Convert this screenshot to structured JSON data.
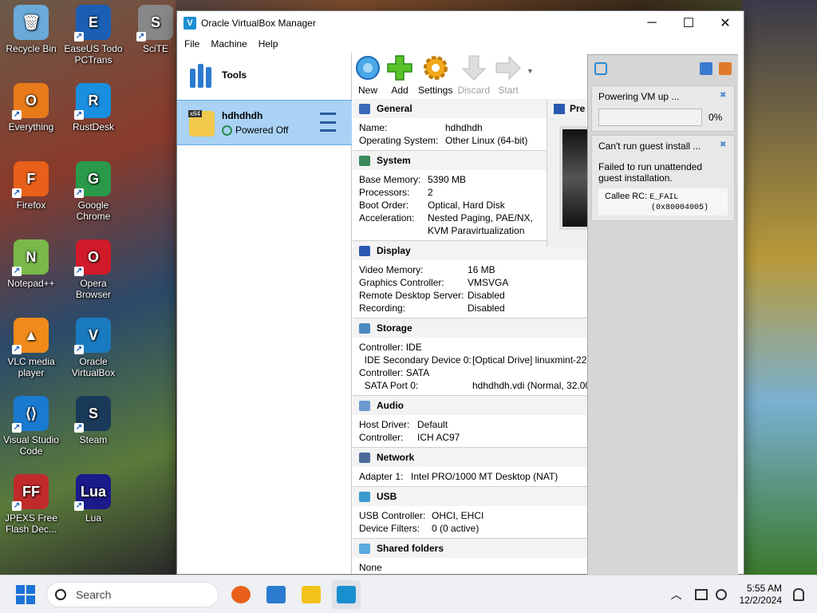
{
  "desktop": {
    "icons": [
      {
        "label": "Recycle Bin",
        "color": "#6aa9d8",
        "glyph": "🗑"
      },
      {
        "label": "EaseUS Todo PCTrans",
        "color": "#1a5fb4",
        "glyph": "E"
      },
      {
        "label": "SciTE",
        "color": "#888888",
        "glyph": "S"
      },
      {
        "label": "Everything",
        "color": "#e87a1a",
        "glyph": "O"
      },
      {
        "label": "RustDesk",
        "color": "#1a8fe0",
        "glyph": "R"
      },
      {
        "label": "Firefox",
        "color": "#e8601a",
        "glyph": "F"
      },
      {
        "label": "Google Chrome",
        "color": "#2a9a4a",
        "glyph": "G"
      },
      {
        "label": "Notepad++",
        "color": "#7ab84a",
        "glyph": "N"
      },
      {
        "label": "Opera Browser",
        "color": "#d01a2a",
        "glyph": "O"
      },
      {
        "label": "VLC media player",
        "color": "#f08a1a",
        "glyph": "▲"
      },
      {
        "label": "Oracle VirtualBox",
        "color": "#1a7ac0",
        "glyph": "V"
      },
      {
        "label": "Visual Studio Code",
        "color": "#1a7ad0",
        "glyph": "⟨⟩"
      },
      {
        "label": "Steam",
        "color": "#1a3a5a",
        "glyph": "S"
      },
      {
        "label": "JPEXS Free Flash Dec...",
        "color": "#c02a2a",
        "glyph": "FF"
      },
      {
        "label": "Lua",
        "color": "#1a1a8a",
        "glyph": "Lua"
      }
    ]
  },
  "window": {
    "title": "Oracle VirtualBox Manager",
    "controls": {
      "minimize": "─",
      "maximize": "☐",
      "close": "✕"
    },
    "menu": [
      "File",
      "Machine",
      "Help"
    ]
  },
  "left": {
    "tools_label": "Tools",
    "vm": {
      "name": "hdhdhdh",
      "state": "Powered Off",
      "os_tag": "x64"
    }
  },
  "toolbar": {
    "new": "New",
    "add": "Add",
    "settings": "Settings",
    "discard": "Discard",
    "start": "Start"
  },
  "details": {
    "general": {
      "title": "General",
      "rows": [
        {
          "k": "Name:",
          "v": "hdhdhdh"
        },
        {
          "k": "Operating System:",
          "v": "Other Linux (64-bit)"
        }
      ]
    },
    "system": {
      "title": "System",
      "rows": [
        {
          "k": "Base Memory:",
          "v": "5390 MB"
        },
        {
          "k": "Processors:",
          "v": "2"
        },
        {
          "k": "Boot Order:",
          "v": "Optical, Hard Disk"
        },
        {
          "k": "Acceleration:",
          "v": "Nested Paging, PAE/NX,"
        },
        {
          "k": "",
          "v": "KVM Paravirtualization"
        }
      ]
    },
    "display": {
      "title": "Display",
      "rows": [
        {
          "k": "Video Memory:",
          "v": "16 MB"
        },
        {
          "k": "Graphics Controller:",
          "v": "VMSVGA"
        },
        {
          "k": "Remote Desktop Server:",
          "v": "Disabled"
        },
        {
          "k": "Recording:",
          "v": "Disabled"
        }
      ]
    },
    "storage": {
      "title": "Storage",
      "rows": [
        {
          "k": "Controller: IDE",
          "v": ""
        },
        {
          "k": "  IDE Secondary Device 0:",
          "v": "[Optical Drive] linuxmint-22"
        },
        {
          "k": "Controller: SATA",
          "v": ""
        },
        {
          "k": "  SATA Port 0:",
          "v": "hdhdhdh.vdi (Normal, 32.00"
        }
      ]
    },
    "audio": {
      "title": "Audio",
      "rows": [
        {
          "k": "Host Driver:",
          "v": "Default"
        },
        {
          "k": "Controller:",
          "v": "ICH AC97"
        }
      ]
    },
    "network": {
      "title": "Network",
      "rows": [
        {
          "k": "Adapter 1:",
          "v": "Intel PRO/1000 MT Desktop (NAT)"
        }
      ]
    },
    "usb": {
      "title": "USB",
      "rows": [
        {
          "k": "USB Controller:",
          "v": "OHCI, EHCI"
        },
        {
          "k": "Device Filters:",
          "v": "0 (0 active)"
        }
      ]
    },
    "shared": {
      "title": "Shared folders",
      "value": "None"
    },
    "preview_title": "Pre"
  },
  "notifications": {
    "powering": {
      "title": "Powering VM up ...",
      "percent": "0%",
      "progress": 0
    },
    "error": {
      "title": "Can't run guest install ...",
      "message": "Failed to run unattended guest installation.",
      "callee_label": "Callee RC:",
      "code": "E_FAIL",
      "hex": "(0x80004005)"
    }
  },
  "taskbar": {
    "search_placeholder": "Search",
    "time": "5:55 AM",
    "date": "12/2/2024",
    "accent": "#1a73d6"
  }
}
